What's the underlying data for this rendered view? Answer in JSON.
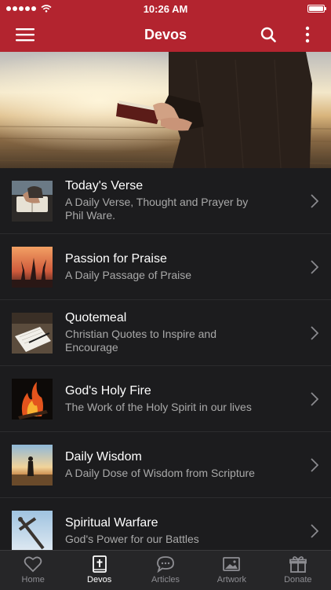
{
  "status_bar": {
    "time": "10:26 AM"
  },
  "nav": {
    "title": "Devos",
    "icons": [
      "menu-icon",
      "search-icon",
      "more-vertical-icon"
    ]
  },
  "items": [
    {
      "title": "Today's Verse",
      "subtitle": "A Daily Verse, Thought and Prayer by Phil Ware."
    },
    {
      "title": "Passion for Praise",
      "subtitle": "A Daily Passage of Praise"
    },
    {
      "title": "Quotemeal",
      "subtitle": "Christian Quotes to Inspire and Encourage"
    },
    {
      "title": "God's Holy Fire",
      "subtitle": "The Work of the Holy Spirit in our lives"
    },
    {
      "title": "Daily Wisdom",
      "subtitle": "A Daily Dose of Wisdom from Scripture"
    },
    {
      "title": "Spiritual Warfare",
      "subtitle": "God's Power for our Battles"
    }
  ],
  "tabs": [
    {
      "label": "Home",
      "icon": "heart-icon",
      "active": false
    },
    {
      "label": "Devos",
      "icon": "bible-icon",
      "active": true
    },
    {
      "label": "Articles",
      "icon": "chat-bubble-icon",
      "active": false
    },
    {
      "label": "Artwork",
      "icon": "image-icon",
      "active": false
    },
    {
      "label": "Donate",
      "icon": "gift-icon",
      "active": false
    }
  ],
  "colors": {
    "brand": "#b3242f",
    "background": "#1c1c1e",
    "subtitle": "#a9a9a9",
    "tab_bar": "#262628"
  }
}
